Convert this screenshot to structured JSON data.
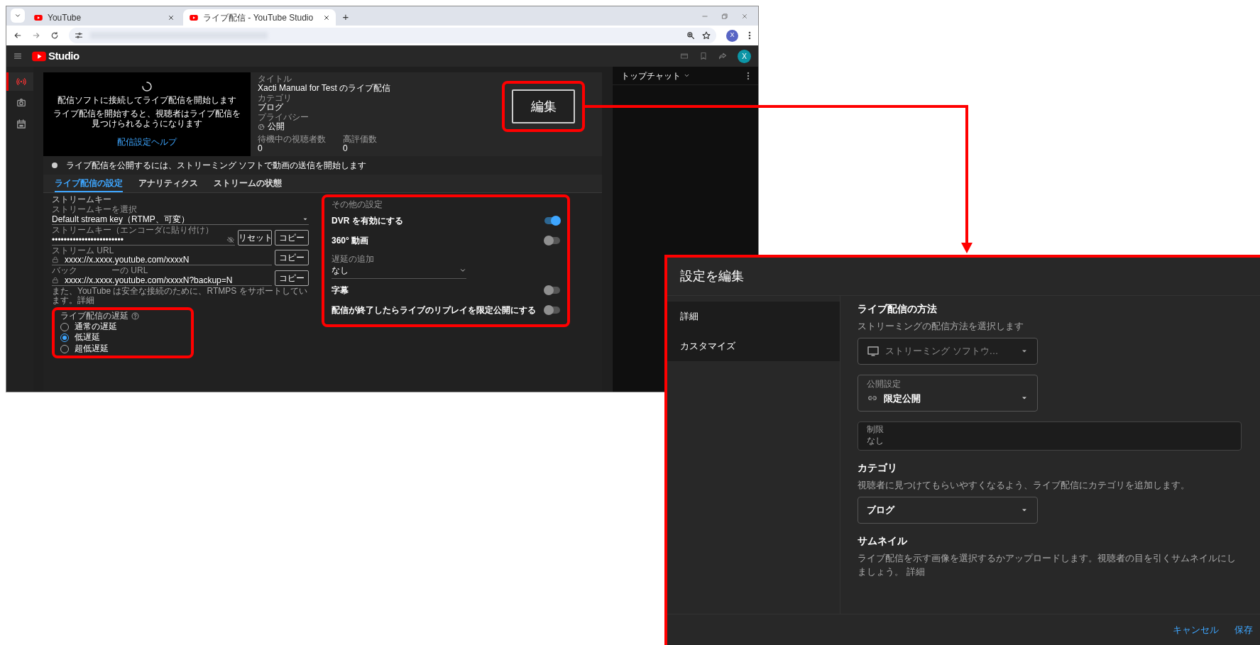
{
  "browser": {
    "tabs": [
      {
        "title": "YouTube",
        "selected": false
      },
      {
        "title": "ライブ配信 - YouTube Studio",
        "selected": true
      }
    ],
    "new_tab": "+",
    "profile": "X"
  },
  "studio": {
    "logo": "Studio",
    "avatar": "X",
    "rail": [
      {
        "kind": "live",
        "selected": true
      },
      {
        "kind": "camera",
        "selected": false
      },
      {
        "kind": "calendar",
        "selected": false
      }
    ],
    "preview": {
      "message": "配信ソフトに接続してライブ配信を開始します",
      "note": "ライブ配信を開始すると、視聴者はライブ配信を見つけられるようになります",
      "help_link": "配信設定ヘルプ"
    },
    "info": [
      {
        "kind": "text",
        "label": "タイトル",
        "value": "Xacti Manual for Test のライブ配信"
      },
      {
        "kind": "text",
        "label": "カテゴリ",
        "value": "ブログ"
      },
      {
        "kind": "privacy",
        "label": "プライバシー",
        "value": "公開"
      }
    ],
    "stats": [
      {
        "label": "待機中の視聴者数",
        "value": "0"
      },
      {
        "label": "高評価数",
        "value": "0"
      }
    ],
    "edit_button": "編集",
    "status": "ライブ配信を公開するには、ストリーミング ソフトで動画の送信を開始します",
    "tabs": [
      {
        "label": "ライブ配信の設定",
        "selected": true
      },
      {
        "label": "アナリティクス",
        "selected": false
      },
      {
        "label": "ストリームの状態",
        "selected": false
      }
    ],
    "stream_key": {
      "heading": "ストリームキー",
      "select": {
        "label": "ストリームキーを選択",
        "value": "Default stream key（RTMP、可変）"
      },
      "key": {
        "label": "ストリームキー（エンコーダに貼り付け）",
        "value": "••••••••••••••••••••••••"
      },
      "reset_button": "リセット",
      "copy_buttons": [
        "コピー",
        "コピー",
        "コピー"
      ],
      "stream_url": {
        "label": "ストリーム URL",
        "value": "xxxx://x.xxxx.youtube.com/xxxxN"
      },
      "backup_url": {
        "label_fragments": [
          "バック",
          "ーの URL"
        ],
        "value": "xxxx://x.xxxx.youtube.com/xxxxN?backup=N"
      },
      "note": "また、YouTube は安全な接続のために、RTMPS をサポートしています。",
      "note_link": "詳細"
    },
    "latency": {
      "heading": "ライブ配信の遅延",
      "options": [
        {
          "label": "通常の遅延",
          "selected": false
        },
        {
          "label": "低遅延",
          "selected": true
        },
        {
          "label": "超低遅延",
          "selected": false
        }
      ]
    },
    "other_settings": {
      "heading": "その他の設定",
      "items": [
        {
          "kind": "toggle",
          "label": "DVR を有効にする",
          "on": true
        },
        {
          "kind": "toggle",
          "label": "360° 動画",
          "on": false
        },
        {
          "kind": "select",
          "label": "遅延の追加",
          "value": "なし"
        },
        {
          "kind": "toggle",
          "label": "字幕",
          "on": false
        },
        {
          "kind": "toggle",
          "label": "配信が終了したらライブのリプレイを限定公開にする",
          "on": false
        }
      ]
    },
    "chat": {
      "title": "トップチャット"
    }
  },
  "dialog": {
    "title": "設定を編集",
    "nav": [
      "詳細",
      "カスタマイズ"
    ],
    "method": {
      "heading": "ライブ配信の方法",
      "description": "ストリーミングの配信方法を選択します",
      "select": {
        "value": "ストリーミング ソフトウ…",
        "disabled": true
      }
    },
    "visibility": {
      "label": "公開設定",
      "value": "限定公開"
    },
    "restriction": {
      "label": "制限",
      "value": "なし"
    },
    "category": {
      "heading": "カテゴリ",
      "description": "視聴者に見つけてもらいやすくなるよう、ライブ配信にカテゴリを追加します。",
      "value": "ブログ"
    },
    "thumbnail": {
      "heading": "サムネイル",
      "description": "ライブ配信を示す画像を選択するかアップロードします。視聴者の目を引くサムネイルにしましょう。",
      "link": "詳細"
    },
    "buttons": [
      "キャンセル",
      "保存"
    ]
  }
}
